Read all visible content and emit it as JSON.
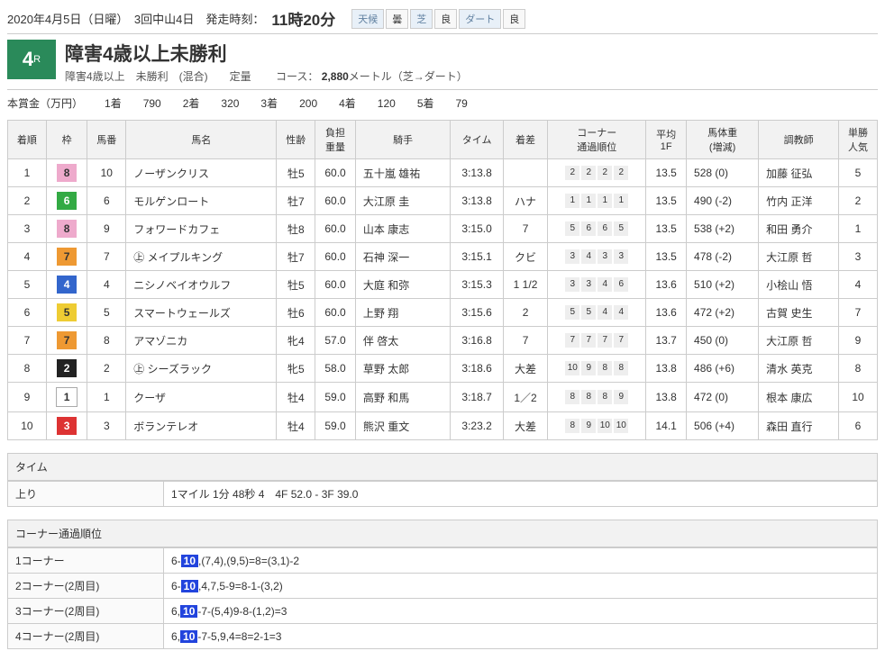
{
  "header": {
    "date": "2020年4月5日（日曜）　3回中山4日　発走時刻：",
    "time": "11時20分",
    "weather": [
      {
        "l": "天候",
        "v": "曇"
      },
      {
        "l": "芝",
        "v": "良"
      },
      {
        "l": "ダート",
        "v": "良"
      }
    ]
  },
  "race": {
    "num": "4",
    "numSuffix": "R",
    "title": "障害4歳以上未勝利",
    "sub1": "障害4歳以上　未勝利　(混合)　　定量",
    "sub2": "コース：",
    "course": "2,880",
    "courseUnit": "メートル（芝→ダート）"
  },
  "prize": {
    "label": "本賞金（万円）",
    "items": [
      [
        "1着",
        "790"
      ],
      [
        "2着",
        "320"
      ],
      [
        "3着",
        "200"
      ],
      [
        "4着",
        "120"
      ],
      [
        "5着",
        "79"
      ]
    ]
  },
  "cols": [
    "着順",
    "枠",
    "馬番",
    "馬名",
    "性齢",
    "負担\n重量",
    "騎手",
    "タイム",
    "着差",
    "コーナー\n通過順位",
    "平均\n1F",
    "馬体重\n(増減)",
    "調教師",
    "単勝\n人気"
  ],
  "rows": [
    {
      "rank": "1",
      "waku": "8",
      "num": "10",
      "name": "ノーザンクリス",
      "sa": "牡5",
      "wt": "60.0",
      "jk": "五十嵐 雄祐",
      "time": "3:13.8",
      "diff": "",
      "cn": [
        "2",
        "2",
        "2",
        "2"
      ],
      "avg": "13.5",
      "bw": "528 (0)",
      "tr": "加藤 征弘",
      "pop": "5"
    },
    {
      "rank": "2",
      "waku": "6",
      "num": "6",
      "name": "モルゲンロート",
      "sa": "牡7",
      "wt": "60.0",
      "jk": "大江原 圭",
      "time": "3:13.8",
      "diff": "ハナ",
      "cn": [
        "1",
        "1",
        "1",
        "1"
      ],
      "avg": "13.5",
      "bw": "490 (-2)",
      "tr": "竹内 正洋",
      "pop": "2"
    },
    {
      "rank": "3",
      "waku": "8",
      "num": "9",
      "name": "フォワードカフェ",
      "sa": "牡8",
      "wt": "60.0",
      "jk": "山本 康志",
      "time": "3:15.0",
      "diff": "7",
      "cn": [
        "5",
        "6",
        "6",
        "5"
      ],
      "avg": "13.5",
      "bw": "538 (+2)",
      "tr": "和田 勇介",
      "pop": "1"
    },
    {
      "rank": "4",
      "waku": "7",
      "num": "7",
      "name": "㊤ メイプルキング",
      "sa": "牡7",
      "wt": "60.0",
      "jk": "石神 深一",
      "time": "3:15.1",
      "diff": "クビ",
      "cn": [
        "3",
        "4",
        "3",
        "3"
      ],
      "avg": "13.5",
      "bw": "478 (-2)",
      "tr": "大江原 哲",
      "pop": "3"
    },
    {
      "rank": "5",
      "waku": "4",
      "num": "4",
      "name": "ニシノベイオウルフ",
      "sa": "牡5",
      "wt": "60.0",
      "jk": "大庭 和弥",
      "time": "3:15.3",
      "diff": "1 1/2",
      "cn": [
        "3",
        "3",
        "4",
        "6"
      ],
      "avg": "13.6",
      "bw": "510 (+2)",
      "tr": "小桧山 悟",
      "pop": "4"
    },
    {
      "rank": "6",
      "waku": "5",
      "num": "5",
      "name": "スマートウェールズ",
      "sa": "牡6",
      "wt": "60.0",
      "jk": "上野 翔",
      "time": "3:15.6",
      "diff": "2",
      "cn": [
        "5",
        "5",
        "4",
        "4"
      ],
      "avg": "13.6",
      "bw": "472 (+2)",
      "tr": "古賀 史生",
      "pop": "7"
    },
    {
      "rank": "7",
      "waku": "7",
      "num": "8",
      "name": "アマゾニカ",
      "sa": "牝4",
      "wt": "57.0",
      "jk": "伴 啓太",
      "time": "3:16.8",
      "diff": "7",
      "cn": [
        "7",
        "7",
        "7",
        "7"
      ],
      "avg": "13.7",
      "bw": "450 (0)",
      "tr": "大江原 哲",
      "pop": "9"
    },
    {
      "rank": "8",
      "waku": "2",
      "num": "2",
      "name": "㊤ シーズラック",
      "sa": "牝5",
      "wt": "58.0",
      "jk": "草野 太郎",
      "time": "3:18.6",
      "diff": "大差",
      "cn": [
        "10",
        "9",
        "8",
        "8"
      ],
      "avg": "13.8",
      "bw": "486 (+6)",
      "tr": "清水 英克",
      "pop": "8"
    },
    {
      "rank": "9",
      "waku": "1",
      "num": "1",
      "name": "クーザ",
      "sa": "牡4",
      "wt": "59.0",
      "jk": "高野 和馬",
      "time": "3:18.7",
      "diff": "1／2",
      "cn": [
        "8",
        "8",
        "8",
        "9"
      ],
      "avg": "13.8",
      "bw": "472 (0)",
      "tr": "根本 康広",
      "pop": "10"
    },
    {
      "rank": "10",
      "waku": "3",
      "num": "3",
      "name": "ボランテレオ",
      "sa": "牡4",
      "wt": "59.0",
      "jk": "熊沢 重文",
      "time": "3:23.2",
      "diff": "大差",
      "cn": [
        "8",
        "9",
        "10",
        "10"
      ],
      "avg": "14.1",
      "bw": "506 (+4)",
      "tr": "森田 直行",
      "pop": "6"
    }
  ],
  "timeSection": {
    "title": "タイム",
    "label": "上り",
    "value": "1マイル 1分 48秒 4　4F 52.0 - 3F 39.0"
  },
  "cornerSection": {
    "title": "コーナー通過順位",
    "rows": [
      {
        "l": "1コーナー",
        "pre": "6-",
        "hl": "10",
        "post": ",(7,4),(9,5)=8=(3,1)-2"
      },
      {
        "l": "2コーナー(2周目)",
        "pre": "6-",
        "hl": "10",
        "post": ",4,7,5-9=8-1-(3,2)"
      },
      {
        "l": "3コーナー(2周目)",
        "pre": "6,",
        "hl": "10",
        "post": "-7-(5,4)9-8-(1,2)=3"
      },
      {
        "l": "4コーナー(2周目)",
        "pre": "6,",
        "hl": "10",
        "post": "-7-5,9,4=8=2-1=3"
      }
    ]
  }
}
